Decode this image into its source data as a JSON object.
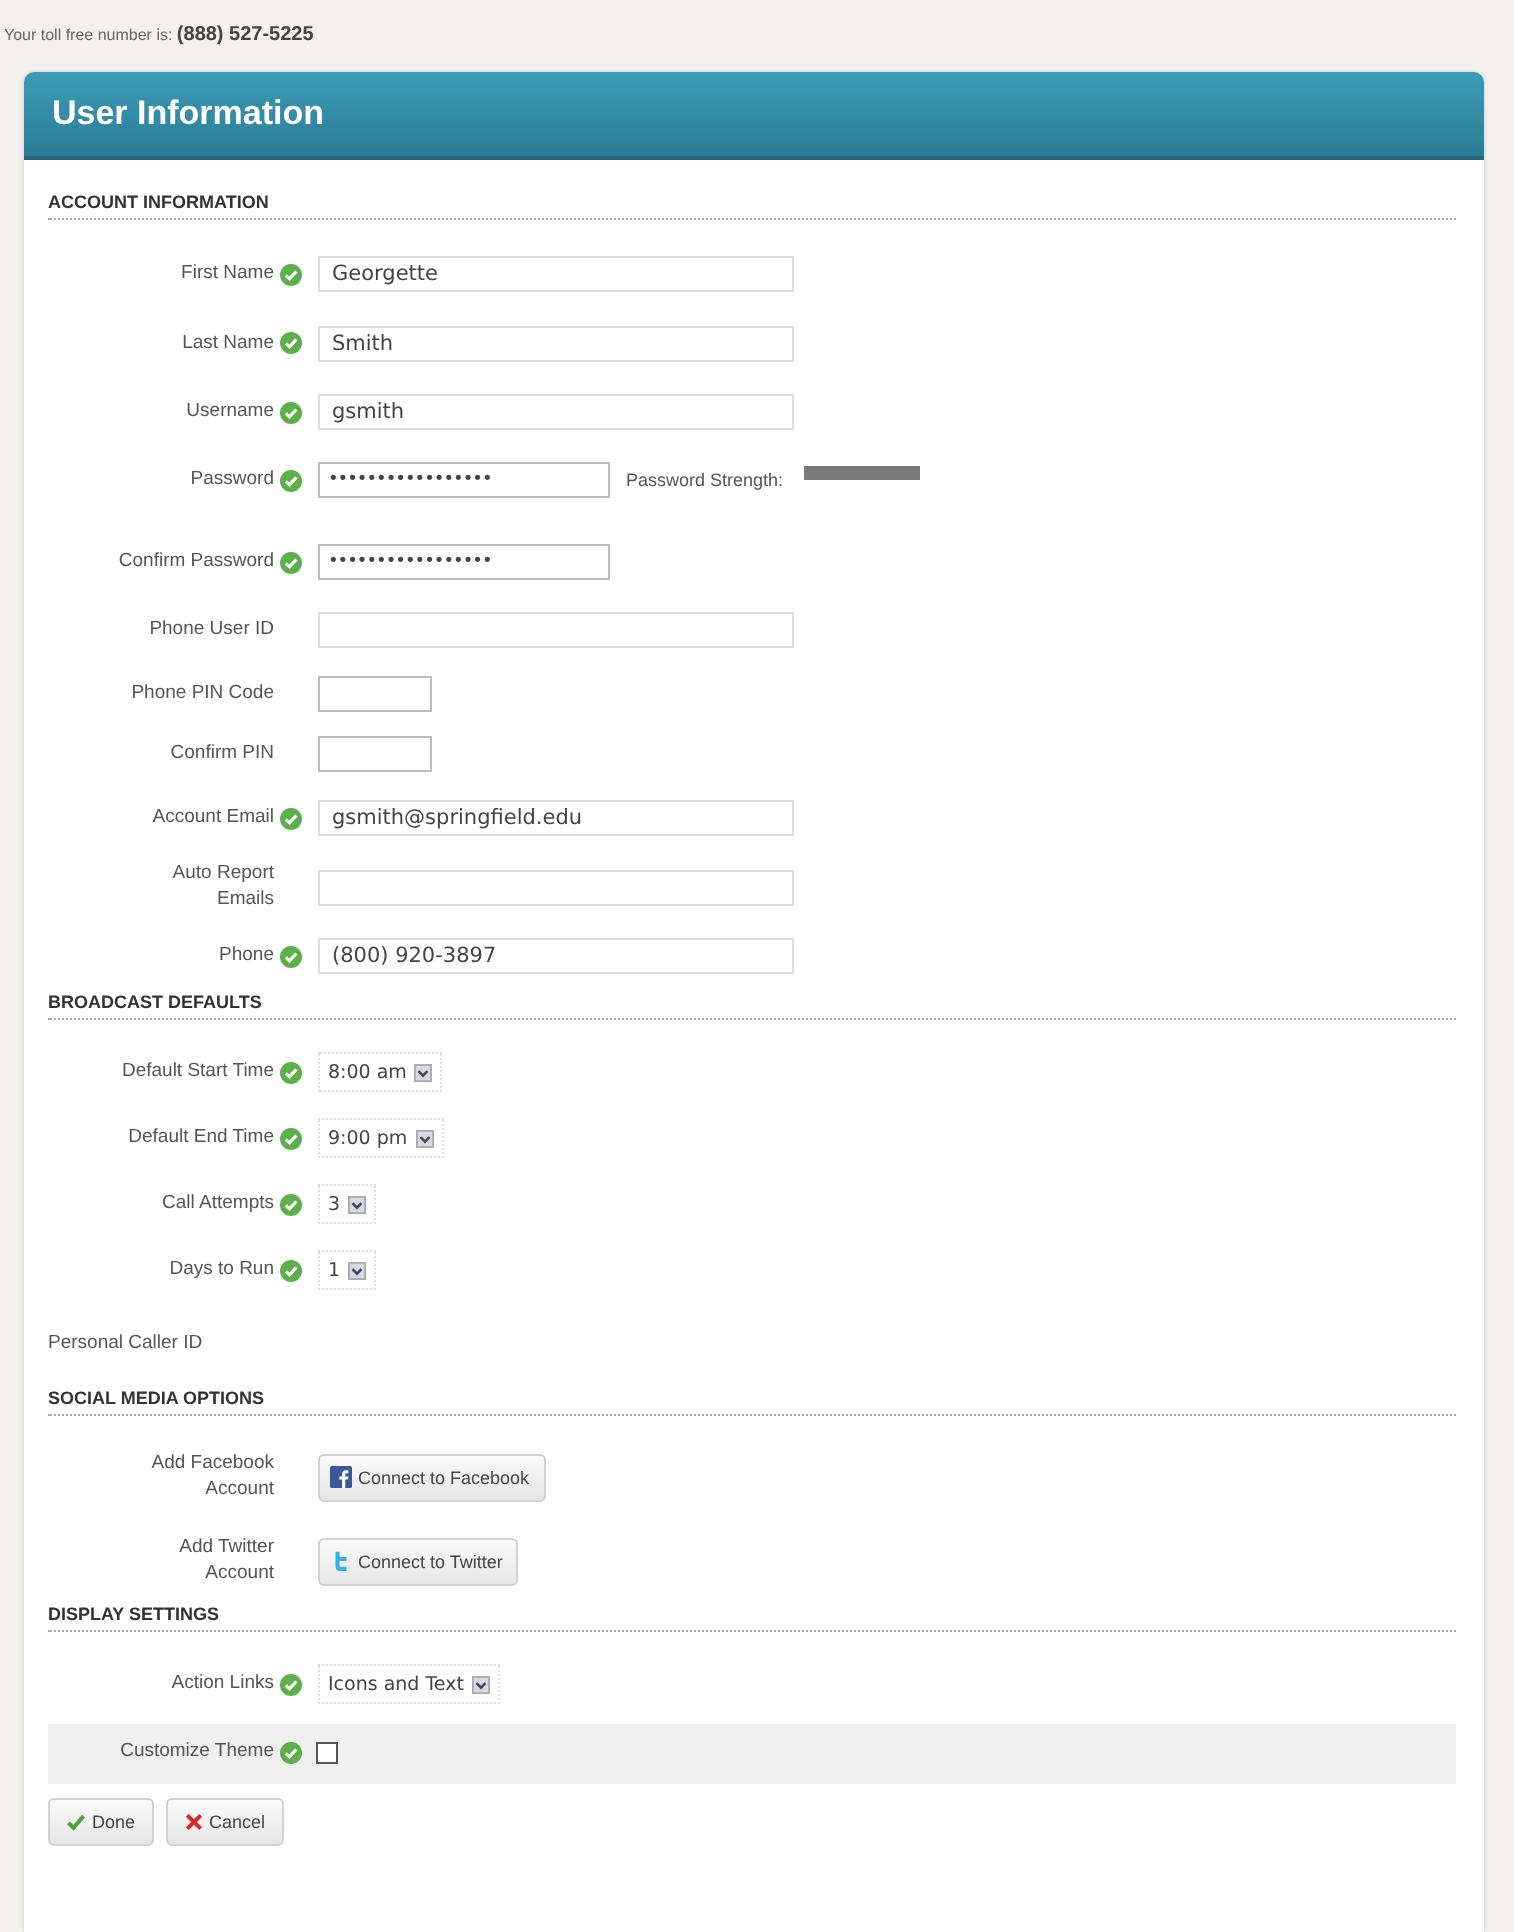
{
  "toll_free": {
    "label": "Your toll free number is:",
    "number": "(888) 527-5225"
  },
  "panel": {
    "title": "User Information"
  },
  "sections": [
    {
      "heading": "ACCOUNT INFORMATION",
      "rows": [
        {
          "kind": "text",
          "label": "First Name",
          "valid": true,
          "value": "Georgette"
        },
        {
          "kind": "text",
          "label": "Last Name",
          "valid": true,
          "value": "Smith"
        },
        {
          "kind": "text",
          "label": "Username",
          "valid": true,
          "value": "gsmith"
        },
        {
          "kind": "password",
          "label": "Password",
          "valid": true,
          "value": "•••••••••••••••••",
          "strength_label": "Password Strength:"
        },
        {
          "kind": "password",
          "label": "Confirm Password",
          "valid": true,
          "value": "•••••••••••••••••"
        },
        {
          "kind": "text",
          "label": "Phone User ID",
          "valid": false
        },
        {
          "kind": "pin",
          "label": "Phone PIN Code",
          "valid": false
        },
        {
          "kind": "pin",
          "label": "Confirm PIN",
          "valid": false
        },
        {
          "kind": "text",
          "label": "Account Email",
          "valid": true,
          "value": "gsmith@springfield.edu"
        },
        {
          "kind": "text",
          "label": "Auto Report Emails",
          "valid": false
        },
        {
          "kind": "text",
          "label": "Phone",
          "valid": true,
          "value": "(800) 920-3897"
        }
      ]
    },
    {
      "heading": "BROADCAST DEFAULTS",
      "rows": [
        {
          "kind": "select",
          "label": "Default Start Time",
          "valid": true,
          "value": "8:00 am"
        },
        {
          "kind": "select",
          "label": "Default End Time",
          "valid": true,
          "value": "9:00 pm"
        },
        {
          "kind": "select",
          "label": "Call Attempts",
          "valid": true,
          "value": "3"
        },
        {
          "kind": "select",
          "label": "Days to Run",
          "valid": true,
          "value": "1"
        },
        {
          "kind": "plain",
          "label": "Personal Caller ID"
        }
      ]
    },
    {
      "heading": "SOCIAL MEDIA OPTIONS",
      "rows": [
        {
          "kind": "facebook",
          "label": "Add Facebook Account",
          "valid": false,
          "button": "Connect to Facebook"
        },
        {
          "kind": "twitter",
          "label": "Add Twitter Account",
          "valid": false,
          "button": "Connect to Twitter"
        }
      ]
    },
    {
      "heading": "DISPLAY SETTINGS",
      "rows": [
        {
          "kind": "select",
          "label": "Action Links",
          "valid": true,
          "value": "Icons and Text"
        },
        {
          "kind": "checkbox",
          "label": "Customize Theme",
          "valid": true,
          "checked": false
        }
      ]
    }
  ],
  "buttons": [
    {
      "kind": "done",
      "label": "Done"
    },
    {
      "kind": "cancel",
      "label": "Cancel"
    }
  ]
}
